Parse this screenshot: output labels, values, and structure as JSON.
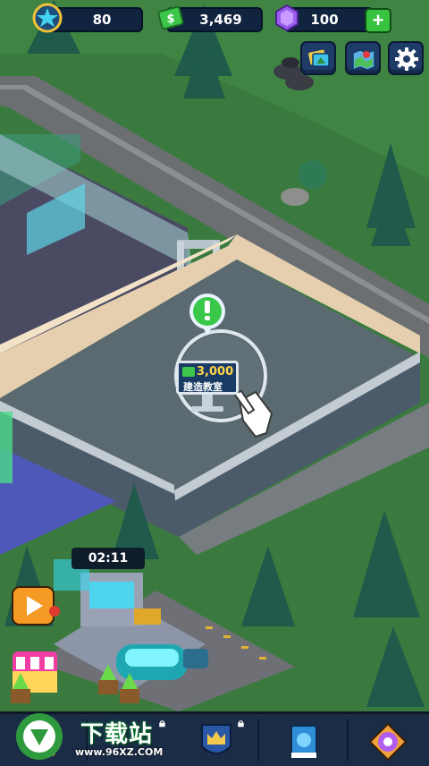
{
  "hud": {
    "stars": "80",
    "cash": "3,469",
    "gems": "100",
    "add_label": "+"
  },
  "toolbar": {
    "icons": [
      "cards-icon",
      "map-icon",
      "gear-icon"
    ]
  },
  "build_sign": {
    "cost": "3,000",
    "label": "建造教室"
  },
  "timer": "02:11",
  "watermark": {
    "text": "下载站",
    "site": "www.96XZ.COM"
  },
  "colors": {
    "hud_bg": "#10233f",
    "grass": "#2f6b35",
    "floor": "#5c6b70",
    "accent_green": "#37c23f",
    "gem_purple": "#9b5cf0"
  }
}
